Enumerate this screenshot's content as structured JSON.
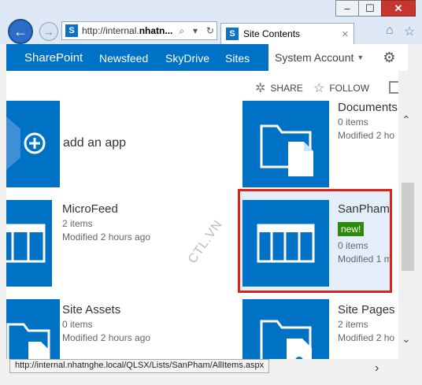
{
  "window": {
    "minimize": "–",
    "maximize": "☐",
    "close": "✕"
  },
  "browser": {
    "back_label": "←",
    "forward_label": "→",
    "address_prefix": "http://internal.",
    "address_host": "nhatn...",
    "search_icon": "⌕",
    "dropdown_icon": "▾",
    "refresh_icon": "↻",
    "tab_title": "Site Contents",
    "tab_close": "✕",
    "home_icon": "⌂",
    "favorites_icon": "☆",
    "tools_icon": "⚙"
  },
  "suitebar": {
    "brand": "SharePoint",
    "nav": [
      "Newsfeed",
      "SkyDrive",
      "Sites"
    ],
    "user": "System Account",
    "user_caret": "▼",
    "settings_icon": "⚙"
  },
  "actions": {
    "share": "SHARE",
    "follow": "FOLLOW"
  },
  "watermark": "CTL.VN",
  "tiles": [
    {
      "title": "Documents",
      "items": "0 items",
      "modified": "Modified 2 ho"
    },
    {
      "title": "add an app"
    },
    {
      "title": "MicroFeed",
      "items": "2 items",
      "modified": "Modified 2 hours ago"
    },
    {
      "title": "SanPham",
      "badge": "new!",
      "items": "0 items",
      "modified": "Modified 1 m"
    },
    {
      "title": "Site Assets",
      "items": "0 items",
      "modified": "Modified 2 hours ago"
    },
    {
      "title": "Site Pages",
      "items": "2 items",
      "modified": "Modified 2 ho"
    }
  ],
  "scroll": {
    "up": "⌃",
    "down": "⌄",
    "right": "›"
  },
  "status_url": "http://internal.nhatnghe.local/QLSX/Lists/SanPham/AllItems.aspx"
}
